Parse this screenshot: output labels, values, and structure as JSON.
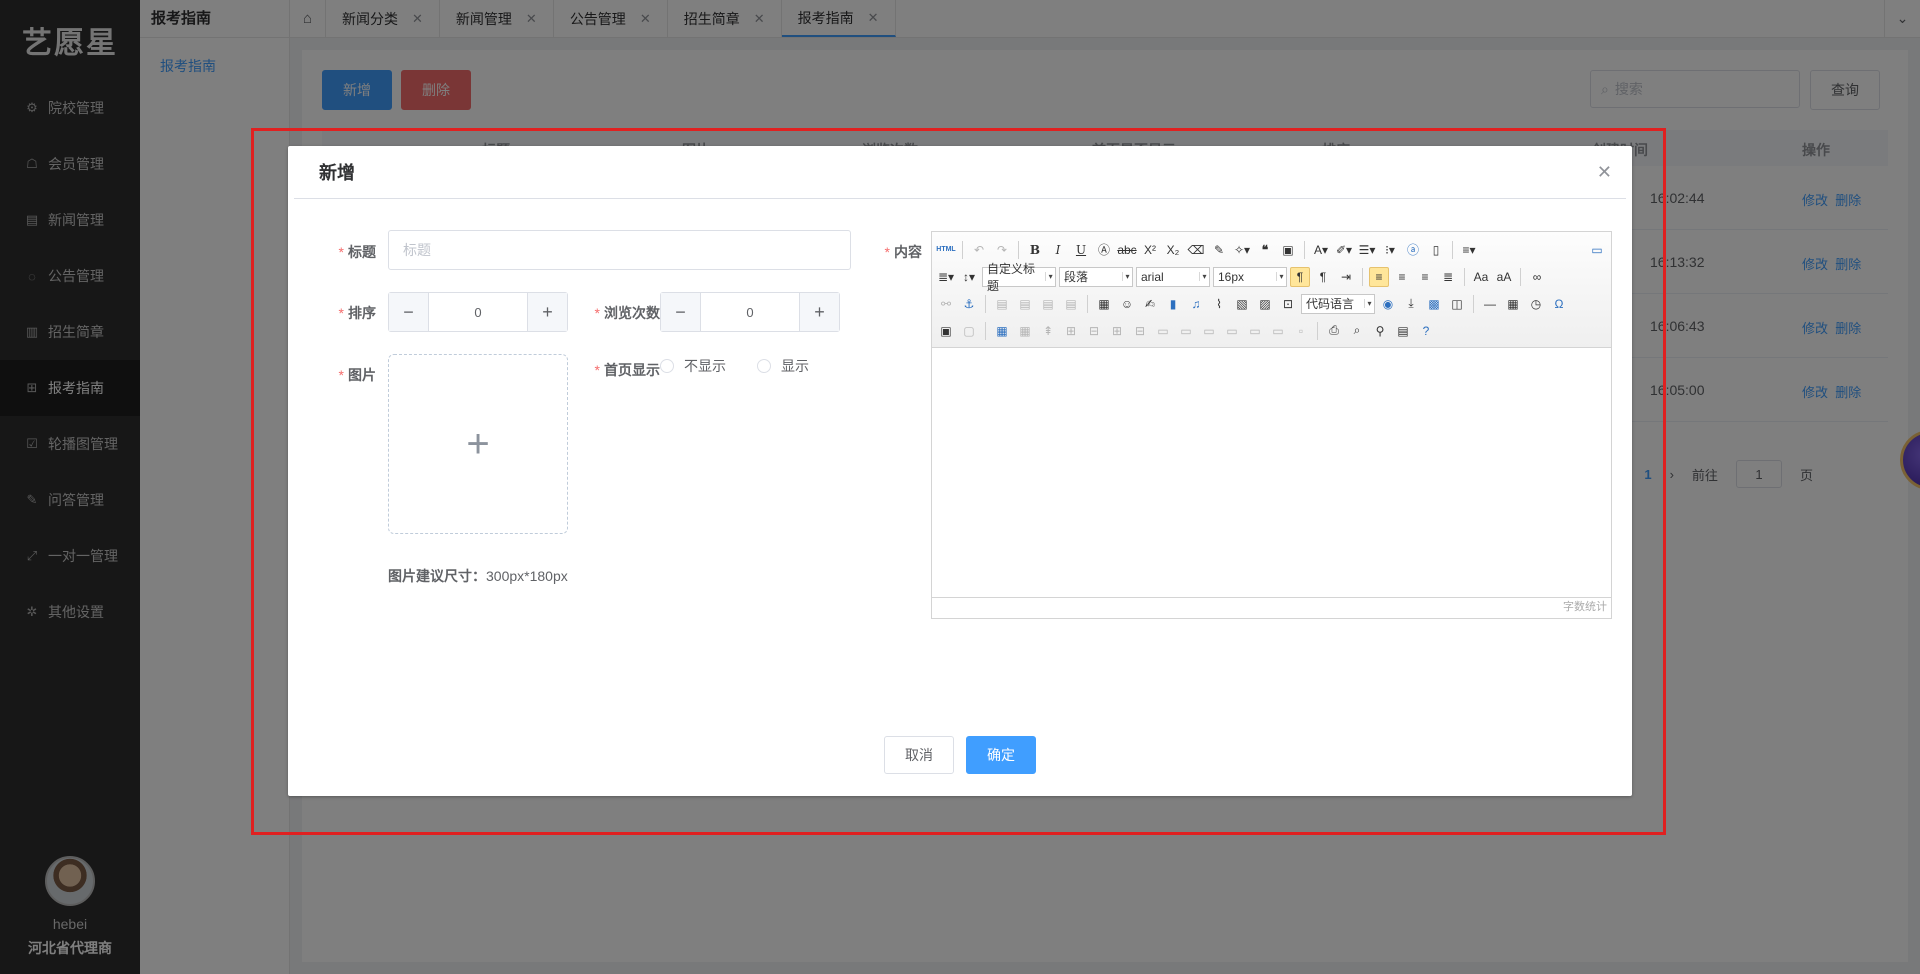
{
  "sidebar": {
    "logo": "艺愿星",
    "items": [
      {
        "icon": "gear-icon",
        "label": "院校管理",
        "glyph": "⚙"
      },
      {
        "icon": "shirt-icon",
        "label": "会员管理",
        "glyph": "☖"
      },
      {
        "icon": "news-icon",
        "label": "新闻管理",
        "glyph": "▤"
      },
      {
        "icon": "bulletin-icon",
        "label": "公告管理",
        "glyph": "◌"
      },
      {
        "icon": "document-icon",
        "label": "招生简章",
        "glyph": "▥"
      },
      {
        "icon": "guide-icon",
        "label": "报考指南",
        "glyph": "⊞",
        "active": true
      },
      {
        "icon": "carousel-icon",
        "label": "轮播图管理",
        "glyph": "☑"
      },
      {
        "icon": "edit-icon",
        "label": "问答管理",
        "glyph": "✎"
      },
      {
        "icon": "link-icon",
        "label": "一对一管理",
        "glyph": "⤢"
      },
      {
        "icon": "settings-icon",
        "label": "其他设置",
        "glyph": "✲"
      }
    ],
    "user": {
      "name": "hebei",
      "role": "河北省代理商"
    }
  },
  "subnav": {
    "title": "报考指南",
    "items": [
      {
        "label": "报考指南"
      }
    ]
  },
  "tabs": {
    "items": [
      {
        "label": "新闻分类"
      },
      {
        "label": "新闻管理"
      },
      {
        "label": "公告管理"
      },
      {
        "label": "招生简章"
      },
      {
        "label": "报考指南",
        "active": true
      }
    ]
  },
  "list": {
    "add_label": "新增",
    "delete_label": "删除",
    "search_placeholder": "搜索",
    "query_label": "查询",
    "columns": [
      "标题",
      "图片",
      "浏览次数",
      "首页是否显示",
      "排序",
      "创建时间",
      "操作"
    ],
    "rows": [
      {
        "time": "16:02:44",
        "edit": "修改",
        "delete": "删除"
      },
      {
        "time": "16:13:32",
        "edit": "修改",
        "delete": "删除"
      },
      {
        "time": "16:06:43",
        "edit": "修改",
        "delete": "删除"
      },
      {
        "time": "16:05:00",
        "edit": "修改",
        "delete": "删除"
      }
    ],
    "pager": {
      "current": "1",
      "goto_prefix": "前往",
      "goto_value": "1",
      "goto_suffix": "页"
    }
  },
  "dialog": {
    "title": "新增",
    "fields": {
      "title_label": "标题",
      "title_placeholder": "标题",
      "title_value": "",
      "sort_label": "排序",
      "sort_value": "0",
      "views_label": "浏览次数",
      "views_value": "0",
      "image_label": "图片",
      "homepage_label": "首页显示",
      "homepage_options": [
        "不显示",
        "显示"
      ],
      "content_label": "内容",
      "image_hint_label": "图片建议尺寸：",
      "image_hint_value": "300px*180px"
    },
    "editor": {
      "heading_combo": "自定义标题",
      "paragraph_combo": "段落",
      "font_combo": "arial",
      "size_combo": "16px",
      "code_combo": "代码语言",
      "word_count": "字数统计"
    },
    "cancel_label": "取消",
    "confirm_label": "确定"
  }
}
